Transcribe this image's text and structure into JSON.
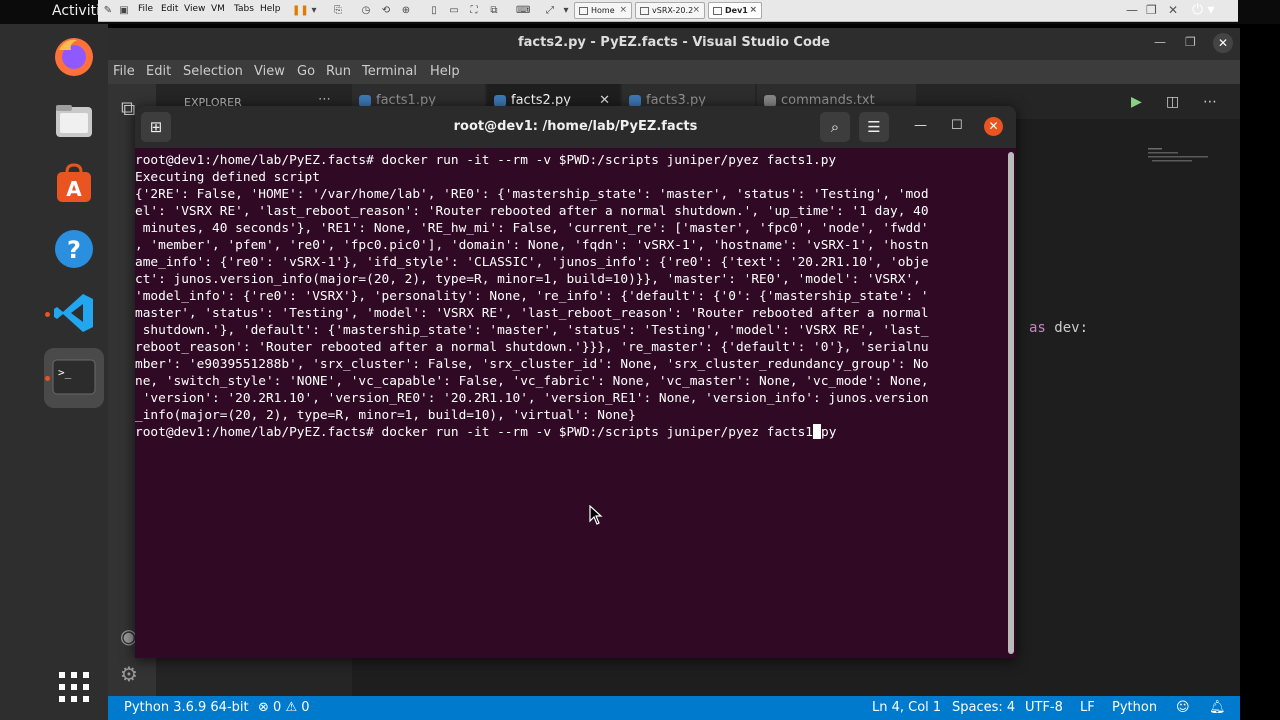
{
  "topbar": {
    "activities": "Activiti",
    "vmware_menu": [
      "File",
      "Edit",
      "View",
      "VM",
      "Tabs",
      "Help"
    ],
    "vmware_tabs": [
      {
        "label": "Home"
      },
      {
        "label": "vSRX-20.2"
      },
      {
        "label": "Dev1"
      }
    ]
  },
  "dock": {
    "items": [
      "firefox",
      "files",
      "app-center",
      "help",
      "vscode",
      "terminal",
      "show-applications"
    ]
  },
  "vscode": {
    "title": "facts2.py - PyEZ.facts - Visual Studio Code",
    "menu": [
      "File",
      "Edit",
      "Selection",
      "View",
      "Go",
      "Run",
      "Terminal",
      "Help"
    ],
    "sidebar_title": "EXPLORER",
    "tabs": [
      {
        "label": "facts1.py"
      },
      {
        "label": "facts2.py"
      },
      {
        "label": "facts3.py"
      },
      {
        "label": "commands.txt"
      }
    ],
    "editor_snippet": {
      "keyword": "as",
      "rest": " dev:"
    },
    "statusbar": {
      "python": "Python 3.6.9 64-bit",
      "errors": "0",
      "warnings": "0",
      "position": "Ln 4, Col 1",
      "spaces": "Spaces: 4",
      "encoding": "UTF-8",
      "eol": "LF",
      "language": "Python"
    }
  },
  "terminal": {
    "title": "root@dev1: /home/lab/PyEZ.facts",
    "lines": [
      "root@dev1:/home/lab/PyEZ.facts# docker run -it --rm -v $PWD:/scripts juniper/pyez facts1.py",
      "Executing defined script",
      "{'2RE': False, 'HOME': '/var/home/lab', 'RE0': {'mastership_state': 'master', 'status': 'Testing', 'mod",
      "el': 'VSRX RE', 'last_reboot_reason': 'Router rebooted after a normal shutdown.', 'up_time': '1 day, 40",
      " minutes, 40 seconds'}, 'RE1': None, 'RE_hw_mi': False, 'current_re': ['master', 'fpc0', 'node', 'fwdd'",
      ", 'member', 'pfem', 're0', 'fpc0.pic0'], 'domain': None, 'fqdn': 'vSRX-1', 'hostname': 'vSRX-1', 'hostn",
      "ame_info': {'re0': 'vSRX-1'}, 'ifd_style': 'CLASSIC', 'junos_info': {'re0': {'text': '20.2R1.10', 'obje",
      "ct': junos.version_info(major=(20, 2), type=R, minor=1, build=10)}}, 'master': 'RE0', 'model': 'VSRX',",
      "'model_info': {'re0': 'VSRX'}, 'personality': None, 're_info': {'default': {'0': {'mastership_state': '",
      "master', 'status': 'Testing', 'model': 'VSRX RE', 'last_reboot_reason': 'Router rebooted after a normal",
      " shutdown.'}, 'default': {'mastership_state': 'master', 'status': 'Testing', 'model': 'VSRX RE', 'last_",
      "reboot_reason': 'Router rebooted after a normal shutdown.'}}}, 're_master': {'default': '0'}, 'serialnu",
      "mber': 'e9039551288b', 'srx_cluster': False, 'srx_cluster_id': None, 'srx_cluster_redundancy_group': No",
      "ne, 'switch_style': 'NONE', 'vc_capable': False, 'vc_fabric': None, 'vc_master': None, 'vc_mode': None,",
      " 'version': '20.2R1.10', 'version_RE0': '20.2R1.10', 'version_RE1': None, 'version_info': junos.version",
      "_info(major=(20, 2), type=R, minor=1, build=10), 'virtual': None}"
    ],
    "prompt_line_before_cursor": "root@dev1:/home/lab/PyEZ.facts# docker run -it --rm -v $PWD:/scripts juniper/pyez facts1",
    "prompt_line_after_cursor": "py"
  },
  "colors": {
    "terminal_bg": "#300a24",
    "vscode_status": "#007acc",
    "ubuntu_orange": "#e95420"
  }
}
